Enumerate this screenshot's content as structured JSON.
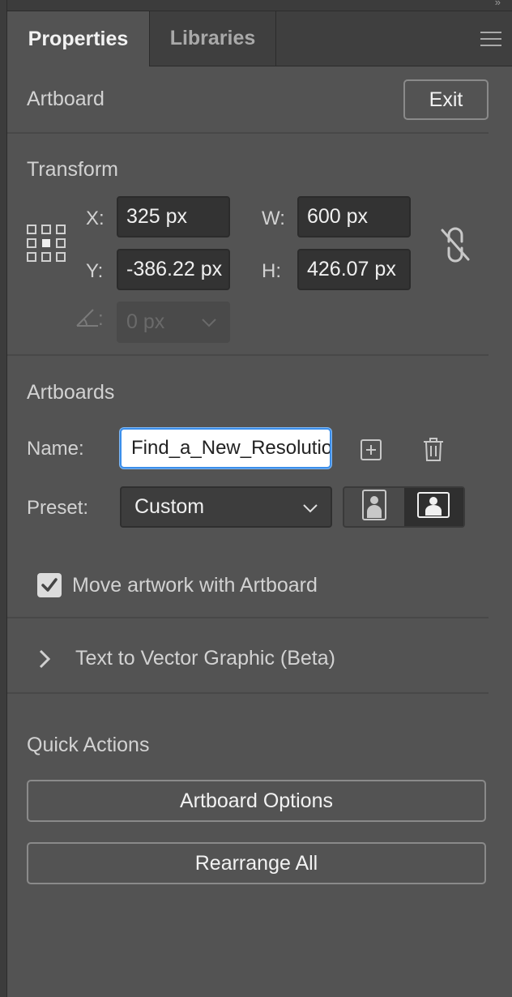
{
  "tabs": [
    {
      "label": "Properties",
      "active": true
    },
    {
      "label": "Libraries",
      "active": false
    }
  ],
  "header": {
    "title": "Artboard",
    "exit_label": "Exit"
  },
  "transform": {
    "title": "Transform",
    "x_label": "X:",
    "x_value": "325 px",
    "y_label": "Y:",
    "y_value": "-386.22 px",
    "w_label": "W:",
    "w_value": "600 px",
    "h_label": "H:",
    "h_value": "426.07 px",
    "angle_label": ":",
    "angle_value": "0 px"
  },
  "artboards": {
    "title": "Artboards",
    "name_label": "Name:",
    "name_value": "Find_a_New_Resolution",
    "preset_label": "Preset:",
    "preset_value": "Custom",
    "move_artwork_label": "Move artwork with Artboard",
    "move_artwork_checked": true
  },
  "text_to_vector": {
    "label": "Text to Vector Graphic (Beta)"
  },
  "quick_actions": {
    "title": "Quick Actions",
    "artboard_options_label": "Artboard Options",
    "rearrange_all_label": "Rearrange All"
  },
  "colors": {
    "panel_bg": "#535353",
    "input_bg": "#333333",
    "focus_blue": "#3b8eea"
  },
  "icons": [
    "menu-icon",
    "reference-point-icon",
    "link-proportions-icon",
    "angle-icon",
    "chevron-down-icon",
    "new-artboard-icon",
    "trash-icon",
    "portrait-icon",
    "landscape-icon",
    "checkmark-icon",
    "chevron-right-icon"
  ]
}
